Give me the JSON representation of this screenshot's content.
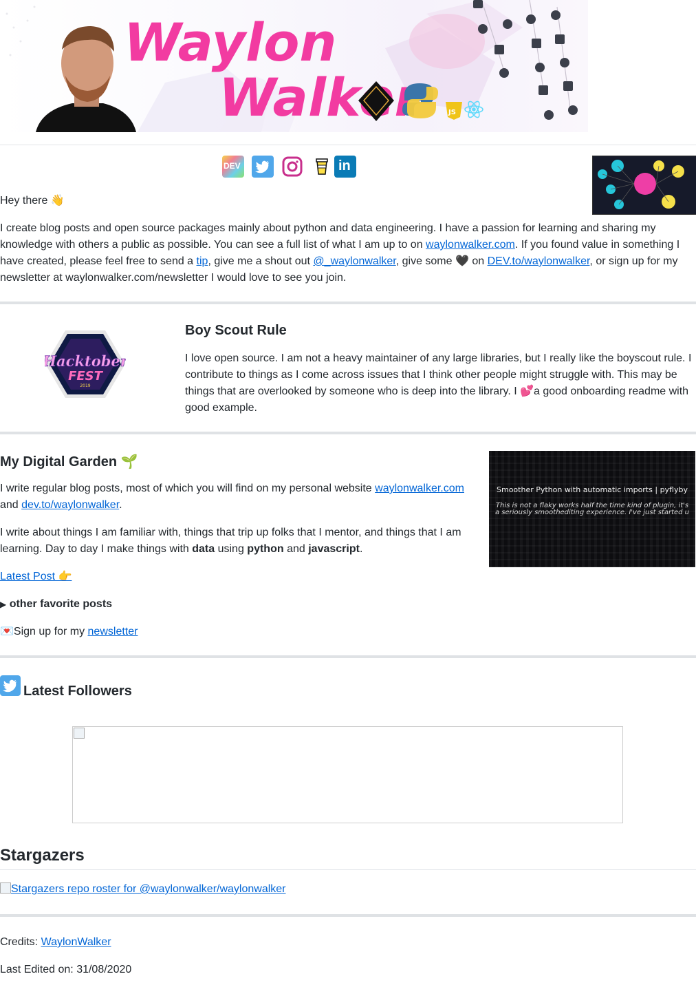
{
  "banner": {
    "name_line1": "Waylon",
    "name_line2": "Walker",
    "accent": "#f23ba1"
  },
  "social_icons": [
    "dev-icon",
    "twitter-icon",
    "instagram-icon",
    "buymeacoffee-icon",
    "linkedin-icon"
  ],
  "intro": {
    "greeting": "Hey there 👋",
    "text1": "I create blog posts and open source packages mainly about python and data engineering. I have a passion for learning and sharing my knowledge with others a public as possible. You can see a full list of what I am up to on ",
    "link_site": "waylonwalker.com",
    "text2": ". If you found value in something I have created, please feel free to send a ",
    "link_tip": "tip",
    "text3": ", give me a shout out ",
    "link_twitter": "@_waylonwalker",
    "text4": ", give some 🖤 on ",
    "link_dev": "DEV.to/waylonwalker",
    "text5": ", or sign up for my newsletter at waylonwalker.com/newsletter I would love to see you join."
  },
  "scout": {
    "title": "Boy Scout Rule",
    "body": "I love open source. I am not a heavy maintainer of any large libraries, but I really like the boyscout rule. I contribute to things as I come across issues that I think other people might struggle with. This may be things that are overlooked by someone who is deep into the library. I 💕a good onboarding readme with good example.",
    "badge_word1": "Hacktober",
    "badge_word2": "FEST",
    "badge_year": "2019"
  },
  "garden": {
    "title": "My Digital Garden 🌱",
    "p1_a": "I write regular blog posts, most of which you will find on my personal website ",
    "p1_link1": "waylonwalker.com",
    "p1_b": "and ",
    "p1_link2": "dev.to/waylonwalker",
    "p1_c": ".",
    "p2_a": "I write about things I am familiar with, things that trip up folks that I mentor, and things that I am learning. Day to day I make things with ",
    "p2_data": "data",
    "p2_b": " using ",
    "p2_python": "python",
    "p2_c": " and ",
    "p2_js": "javascript",
    "p2_d": ".",
    "latest_post": "Latest Post 👉",
    "details_label": "other favorite posts",
    "newsletter_a": "💌Sign up for my ",
    "newsletter_link": "newsletter",
    "card_title": "Smoother Python with automatic imports | pyflyby",
    "card_sub1": "This is not a flaky works half the time kind of plugin, it's",
    "card_sub2": "a seriously smoothediting experience.  I've just started u"
  },
  "followers": {
    "title": "Latest Followers"
  },
  "stargazers": {
    "title": "Stargazers",
    "alt": "Stargazers repo roster for @waylonwalker/waylonwalker"
  },
  "credits": {
    "label": "Credits: ",
    "link": "WaylonWalker",
    "edited": "Last Edited on: 31/08/2020"
  }
}
